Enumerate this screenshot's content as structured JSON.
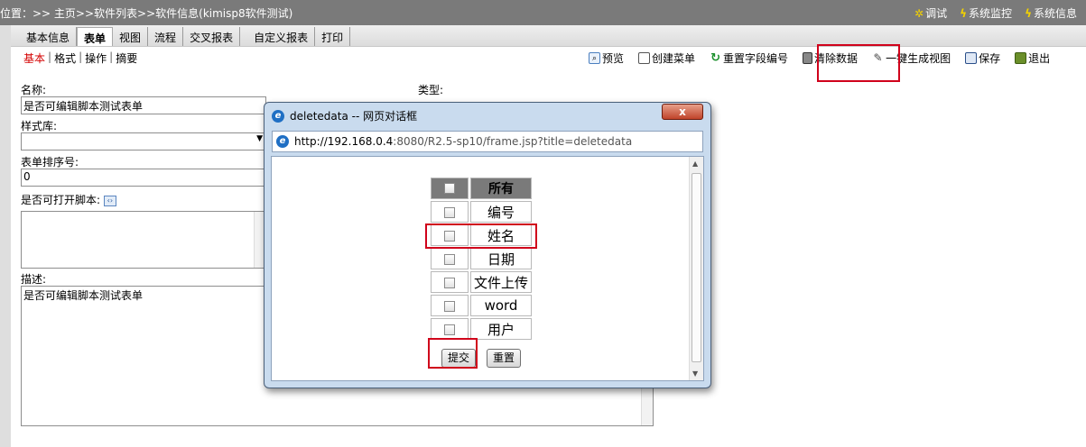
{
  "topbar": {
    "breadcrumb": "位置：>> 主页>>软件列表>>软件信息(kimisp8软件测试)",
    "tools": [
      "调试",
      "系统监控",
      "系统信息"
    ]
  },
  "tabs": [
    "基本信息",
    "表单",
    "视图",
    "流程",
    "交叉报表",
    "自定义报表",
    "打印"
  ],
  "active_tab": "表单",
  "subnav": {
    "items": [
      "基本",
      "格式",
      "操作",
      "摘要"
    ],
    "separator": "|",
    "active": "基本"
  },
  "toolbar": {
    "preview": "预览",
    "create_menu": "创建菜单",
    "reset_field_no": "重置字段编号",
    "clear_data": "清除数据",
    "gen_view": "一键生成视图",
    "save": "保存",
    "exit": "退出"
  },
  "form": {
    "name_label": "名称:",
    "name_value": "是否可编辑脚本测试表单",
    "type_label": "类型:",
    "style_label": "样式库:",
    "style_value": "",
    "order_label": "表单排序号:",
    "order_value": "0",
    "script_label": "是否可打开脚本:",
    "desc_label": "描述:",
    "desc_value": "是否可编辑脚本测试表单"
  },
  "dialog": {
    "title": "deletedata -- 网页对话框",
    "close": "x",
    "url_host": "http://192.168.0.4",
    "url_rest": ":8080/R2.5-sp10/frame.jsp?title=deletedata",
    "header": "所有",
    "fields": [
      "编号",
      "姓名",
      "日期",
      "文件上传",
      "word",
      "用户"
    ],
    "submit": "提交",
    "reset": "重置"
  },
  "colors": {
    "highlight": "#d0021b",
    "topbar_bg": "#7a7a7a",
    "dialog_frame": "#c9dbee",
    "subnav_active": "#d40000"
  }
}
